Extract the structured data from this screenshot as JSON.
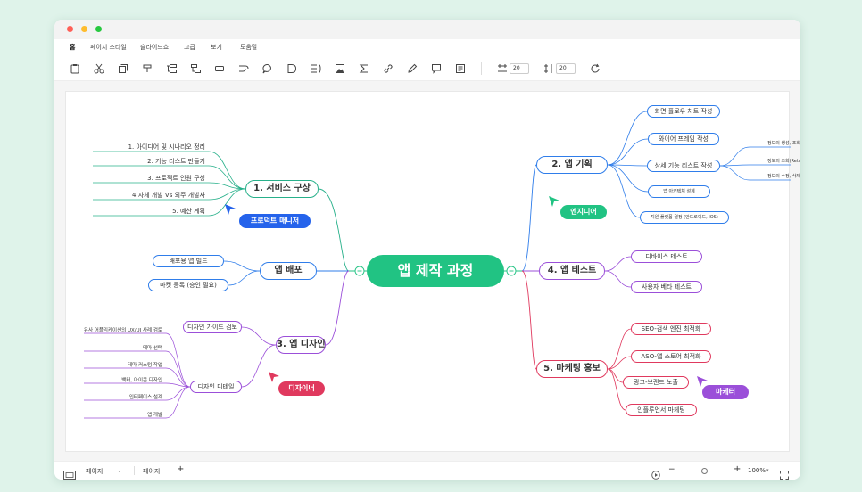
{
  "menu": {
    "items": [
      "홈",
      "페이지 스타일",
      "슬라이드쇼",
      "고급",
      "보기",
      "도움말"
    ]
  },
  "toolbar": {
    "icons": [
      "clipboard-icon",
      "scissors-icon",
      "copy-icon",
      "format-painter-icon",
      "insert-topic-icon",
      "insert-subtopic-icon",
      "floating-topic-icon",
      "relationship-icon",
      "callout-icon",
      "summary-icon",
      "boundary-icon",
      "image-icon",
      "formula-icon",
      "link-icon",
      "pen-icon",
      "comment-icon",
      "note-icon"
    ],
    "width_value": "20",
    "height_value": "20",
    "refresh_icon": "refresh-icon"
  },
  "mindmap": {
    "root": "앱 제작 과정",
    "colors": {
      "green": "#21c383",
      "teal": "#27b08a",
      "blue": "#2f7dea",
      "purple": "#9b4fd9",
      "red": "#e0395e",
      "gray": "#444444"
    },
    "branches": [
      {
        "label": "1. 서비스 구상",
        "color": "#27b08a",
        "children": [
          "1. 아이디어 및 시나리오 정리",
          "2. 기능 리스트 만들기",
          "3. 프로젝트 인원 구성",
          "4.자체 개발 Vs 외주 개발사",
          "5. 예산 계획"
        ]
      },
      {
        "label": "앱 배포",
        "color": "#2f7dea",
        "children": [
          "배포용 앱 빌드",
          "마켓 등록 (승인 필요)"
        ]
      },
      {
        "label": "3. 앱 디자인",
        "color": "#9b4fd9",
        "children": [
          "디자인 가이드 검토",
          "디자인 디테일"
        ],
        "details": [
          "유사 어플리케이션의 UX/UI 사례 검토",
          "테마 선택",
          "테마 커스텀 작업",
          "백터, 아이콘 디자인",
          "인터페이스 설계",
          "앱 개발"
        ]
      },
      {
        "label": "2. 앱 기획",
        "color": "#2f7dea",
        "children": [
          "화면 플로우 차트 작성",
          "와이어 프레임 작성",
          "상세 기능 리스트 작성",
          "앱 아키텍처 설계",
          "지원 플랫폼 결정 (안드로이드, IOS)"
        ],
        "details": [
          "정보의 생성, 조회,",
          "정보의 조회(Retrieve",
          "정보의 수정, 삭제"
        ]
      },
      {
        "label": "4. 앱 테스트",
        "color": "#9b4fd9",
        "children": [
          "디바이스 테스트",
          "사용자 베타 테스트"
        ]
      },
      {
        "label": "5. 마케팅 홍보",
        "color": "#e0395e",
        "children": [
          "SEO-검색 엔진 최적화",
          "ASO-앱 스토어 최적화",
          "광고-브랜드 노출",
          "인플루언서 마케팅"
        ]
      }
    ],
    "roles": [
      {
        "label": "프로덕트 매니저",
        "color": "#2563eb"
      },
      {
        "label": "엔지니어",
        "color": "#21c383"
      },
      {
        "label": "디자이너",
        "color": "#e0395e"
      },
      {
        "label": "마케터",
        "color": "#9b4fd9"
      }
    ]
  },
  "statusbar": {
    "page1": "페이지",
    "page2": "페이지",
    "zoom": "100%",
    "plus": "+",
    "minus": "−"
  }
}
